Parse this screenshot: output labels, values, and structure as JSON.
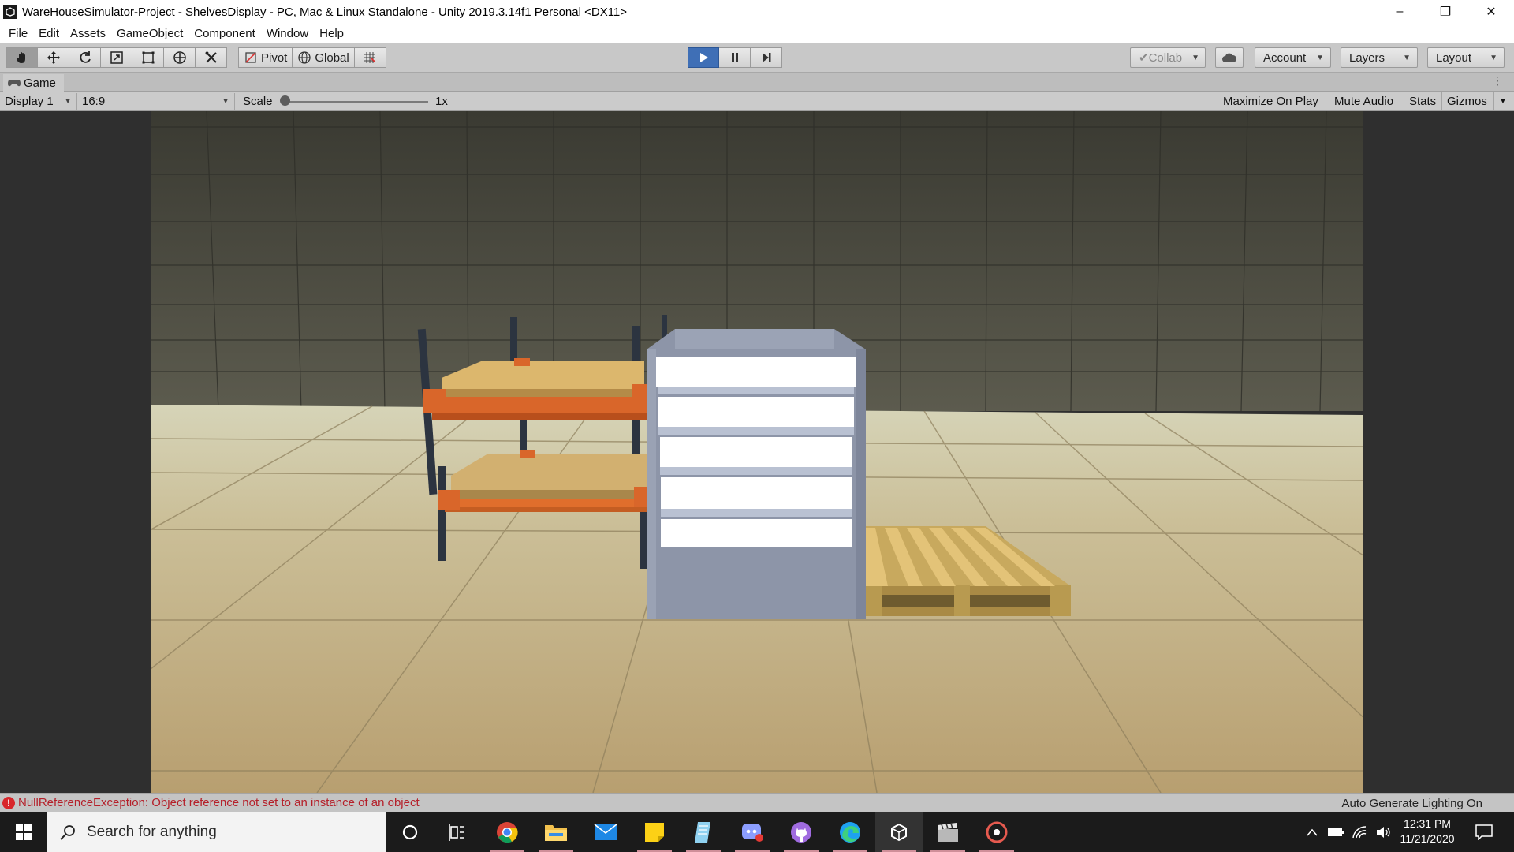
{
  "window": {
    "title": "WareHouseSimulator-Project - ShelvesDisplay - PC, Mac & Linux Standalone - Unity 2019.3.14f1 Personal <DX11>",
    "minimize": "–",
    "restore": "❐",
    "close": "✕"
  },
  "menu": [
    "File",
    "Edit",
    "Assets",
    "GameObject",
    "Component",
    "Window",
    "Help"
  ],
  "toolbar": {
    "pivot": "Pivot",
    "global": "Global",
    "collab": "Collab",
    "account": "Account",
    "layers": "Layers",
    "layout": "Layout"
  },
  "tab": {
    "label": "Game"
  },
  "gameview": {
    "display": "Display 1",
    "aspect": "16:9",
    "scale_label": "Scale",
    "scale_value": "1x",
    "maximize": "Maximize On Play",
    "mute": "Mute Audio",
    "stats": "Stats",
    "gizmos": "Gizmos"
  },
  "status": {
    "error_icon": "!",
    "error": "NullReferenceException: Object reference not set to an instance of an object",
    "lighting": "Auto Generate Lighting On"
  },
  "taskbar": {
    "search_placeholder": "Search for anything",
    "time": "12:31 PM",
    "date": "11/21/2020"
  },
  "colors": {
    "play_active": "#3f6fb6",
    "error_text": "#b5202a",
    "shelf_orange": "#d9662a",
    "board_tan": "#d8b66a",
    "rack_white": "#ffffff",
    "pallet_wood": "#d9b865"
  }
}
